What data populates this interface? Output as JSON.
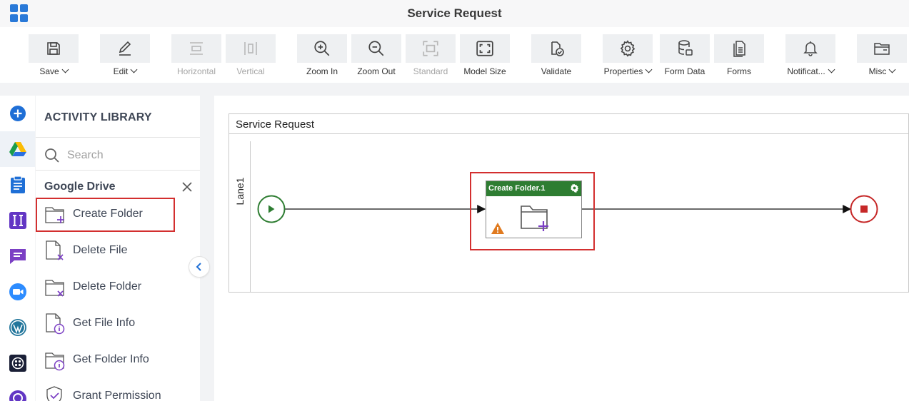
{
  "window": {
    "title": "Service Request"
  },
  "toolbar": {
    "save": "Save",
    "edit": "Edit",
    "horizontal": "Horizontal",
    "vertical": "Vertical",
    "zoom_in": "Zoom In",
    "zoom_out": "Zoom Out",
    "standard": "Standard",
    "model_size": "Model Size",
    "validate": "Validate",
    "properties": "Properties",
    "form_data": "Form Data",
    "forms": "Forms",
    "notifications": "Notificat...",
    "misc": "Misc"
  },
  "library": {
    "heading": "ACTIVITY LIBRARY",
    "search_placeholder": "Search",
    "group": "Google Drive",
    "items": [
      {
        "label": "Create Folder",
        "icon": "folder-add-icon"
      },
      {
        "label": "Delete File",
        "icon": "file-delete-icon"
      },
      {
        "label": "Delete Folder",
        "icon": "folder-delete-icon"
      },
      {
        "label": "Get File Info",
        "icon": "file-info-icon"
      },
      {
        "label": "Get Folder Info",
        "icon": "folder-info-icon"
      },
      {
        "label": "Grant Permission",
        "icon": "shield-check-icon"
      }
    ]
  },
  "rail": [
    "add-icon",
    "google-drive-icon",
    "clipboard-icon",
    "pipe-icon",
    "chat-icon",
    "zoom-video-icon",
    "wordpress-icon",
    "twilio-icon",
    "support-icon"
  ],
  "canvas": {
    "pool_title": "Service Request",
    "lane": "Lane1",
    "task": {
      "title": "Create Folder.1"
    }
  },
  "colors": {
    "accent": "#2979d8",
    "task_header": "#2e7d32",
    "start": "#2e7d32",
    "end": "#c62828",
    "highlight": "#d32f2f",
    "icon_purple": "#7b3fc4"
  }
}
